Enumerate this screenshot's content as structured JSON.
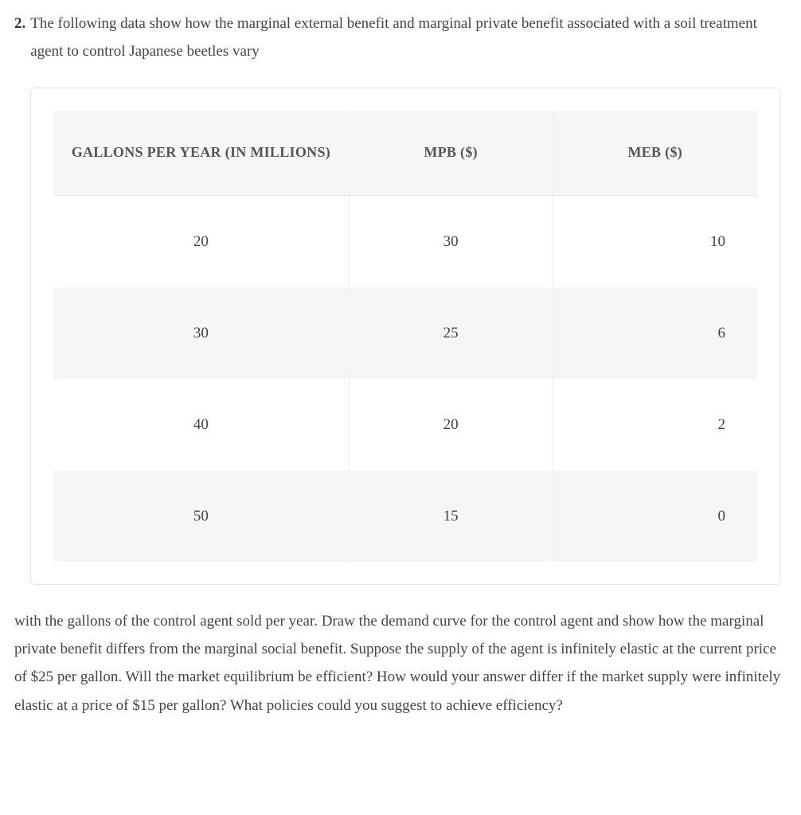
{
  "question": {
    "number": "2.",
    "intro": "The following data show how the marginal external benefit and marginal private benefit associated with a soil treatment agent to control Japanese beetles vary",
    "continuation": "with the gallons of the control agent sold per year. Draw the demand curve for the control agent and show how the marginal private benefit differs from the marginal social benefit. Suppose the supply of the agent is infinitely elastic at the current price of $25 per gallon. Will the market equilibrium be efficient? How would your answer differ if the market supply were infinitely elastic at a price of $15 per gallon? What policies could you suggest to achieve efficiency?"
  },
  "chart_data": {
    "type": "table",
    "columns": [
      "GALLONS PER YEAR (IN MILLIONS)",
      "MPB ($)",
      "MEB ($)"
    ],
    "rows": [
      {
        "gallons": "20",
        "mpb": "30",
        "meb": "10"
      },
      {
        "gallons": "30",
        "mpb": "25",
        "meb": "6"
      },
      {
        "gallons": "40",
        "mpb": "20",
        "meb": "2"
      },
      {
        "gallons": "50",
        "mpb": "15",
        "meb": "0"
      }
    ]
  }
}
